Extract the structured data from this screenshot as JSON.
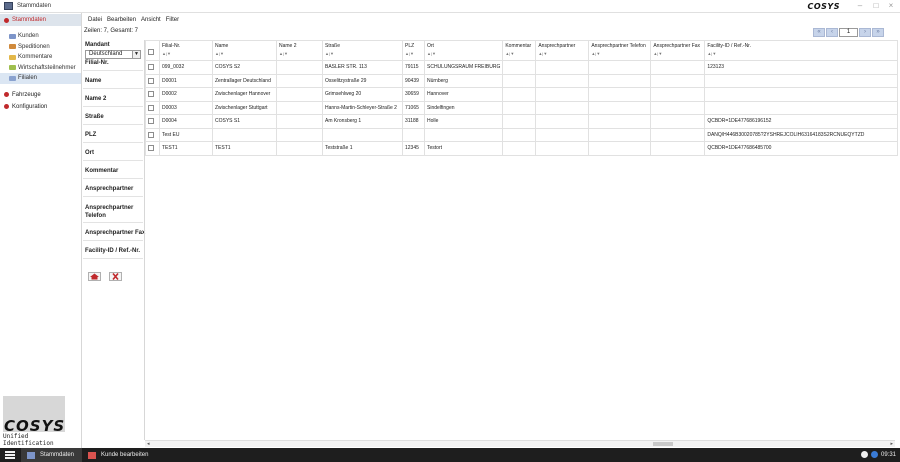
{
  "window": {
    "title": "Stammdaten",
    "brand": "COSYS"
  },
  "nav": {
    "sections": [
      {
        "label": "Stammdaten",
        "active": true
      },
      {
        "label": "Fahrzeuge",
        "active": false
      },
      {
        "label": "Konfiguration",
        "active": false
      }
    ],
    "items": [
      {
        "label": "Kunden",
        "icon": "customers-icon",
        "selected": false
      },
      {
        "label": "Speditionen",
        "icon": "truck-icon",
        "selected": false
      },
      {
        "label": "Kommentare",
        "icon": "comment-icon",
        "selected": false
      },
      {
        "label": "Wirtschaftsteilnehmer",
        "icon": "folder-icon",
        "selected": false
      },
      {
        "label": "Filialen",
        "icon": "branch-icon",
        "selected": true
      }
    ],
    "logo_text": "COSYS",
    "logo_tagline": "Unified Identification"
  },
  "menu": [
    "Datei",
    "Bearbeiten",
    "Ansicht",
    "Filter"
  ],
  "filter": {
    "rowcount": "Zeilen: 7, Gesamt: 7",
    "mandant_label": "Mandant",
    "mandant_value": "Deutschland",
    "fields": [
      "Filial-Nr.",
      "Name",
      "Name 2",
      "Straße",
      "PLZ",
      "Ort",
      "Kommentar",
      "Ansprechpartner",
      "Ansprechpartner Telefon",
      "Ansprechpartner Fax",
      "Facility-ID / Ref.-Nr."
    ]
  },
  "pager": {
    "page": "1"
  },
  "table": {
    "columns": [
      "Filial-Nr.",
      "Name",
      "Name 2",
      "Straße",
      "PLZ",
      "Ort",
      "Kommentar",
      "Ansprechpartner",
      "Ansprechpartner Telefon",
      "Ansprechpartner Fax",
      "Facility-ID / Ref.-Nr."
    ],
    "rows": [
      [
        "099_0032",
        "COSYS S2",
        "",
        "BASLER STR. 113",
        "79115",
        "SCHULUNGSRAUM FREIBURG",
        "",
        "",
        "",
        "",
        "123123"
      ],
      [
        "D0001",
        "Zentrallager Deutschland",
        "",
        "Osselitzystraße 29",
        "90439",
        "Nürnberg",
        "",
        "",
        "",
        "",
        ""
      ],
      [
        "D0002",
        "Zwischenlager Hannover",
        "",
        "Grimsehlweg 20",
        "30659",
        "Hannover",
        "",
        "",
        "",
        "",
        ""
      ],
      [
        "D0003",
        "Zwischenlager Stuttgart",
        "",
        "Hanns-Martin-Schleyer-Straße 2",
        "71065",
        "Sindelfingen",
        "",
        "",
        "",
        "",
        ""
      ],
      [
        "D0004",
        "COSYS S1",
        "",
        "Am Kronsberg 1",
        "31188",
        "Holle",
        "",
        "",
        "",
        "",
        "QCBDR=1DE477686196152"
      ],
      [
        "Test EU",
        "",
        "",
        "",
        "",
        "",
        "",
        "",
        "",
        "",
        "DANQ/H446B30020785?2YSHREJCOLIH63164183S2RCNUEQYTZD"
      ],
      [
        "TEST1",
        "TEST1",
        "",
        "Teststraße 1",
        "12345",
        "Testort",
        "",
        "",
        "",
        "",
        "QCBDR=1DE477686485700"
      ]
    ]
  },
  "taskbar": {
    "tasks": [
      {
        "label": "Stammdaten",
        "active": true
      },
      {
        "label": "Kunde bearbeiten",
        "active": false
      }
    ],
    "clock": "09:31"
  },
  "colors": {
    "accent": "#c0292c",
    "selected_bg": "#dbe6f3",
    "taskbar": "#1e1e1e"
  }
}
